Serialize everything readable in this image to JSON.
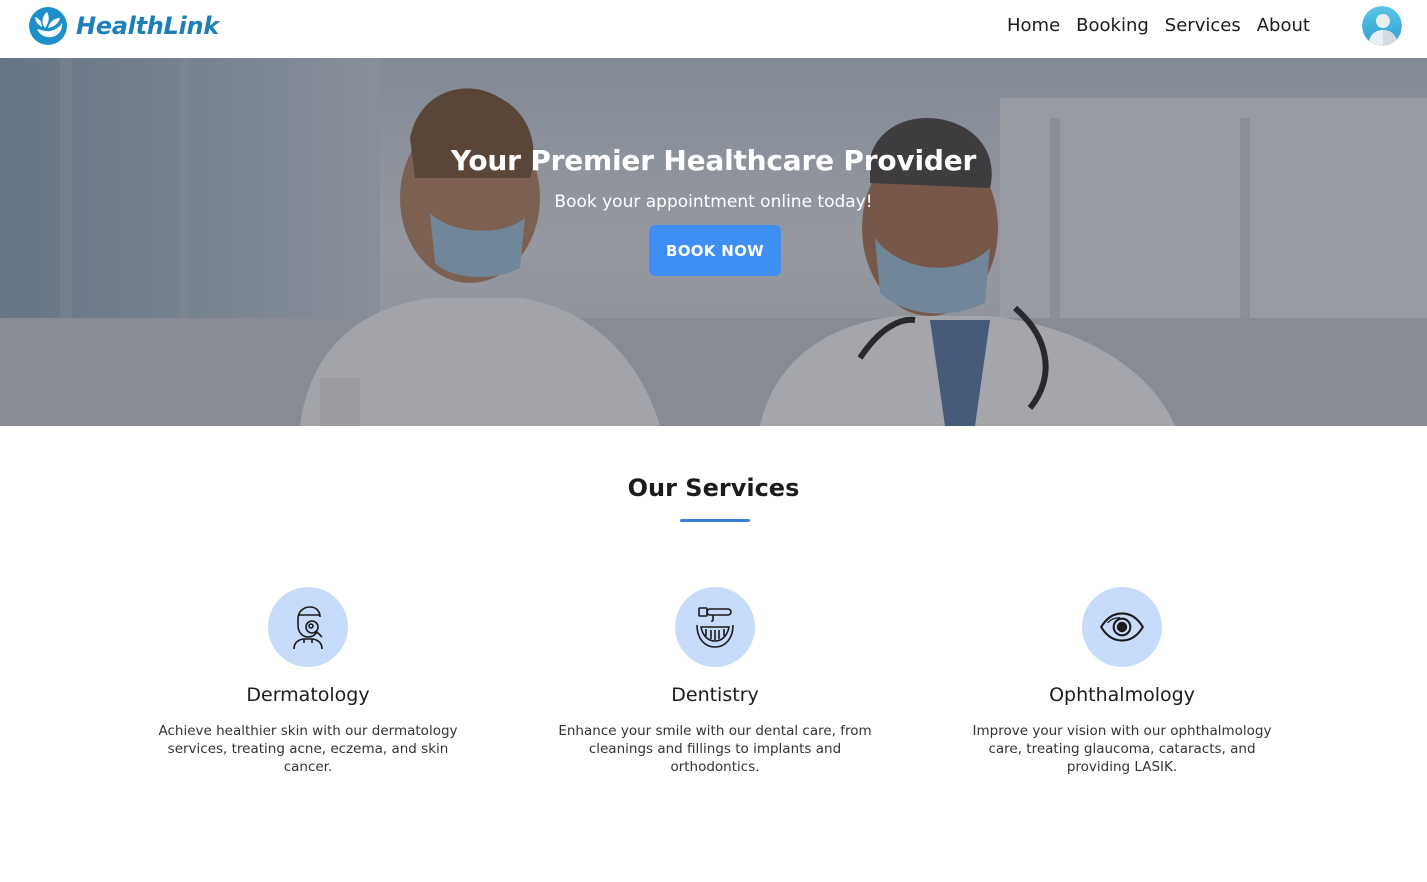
{
  "brand": {
    "name": "HealthLink",
    "logo_icon": "leaf-hand-icon",
    "color": "#1e7fb8"
  },
  "nav": {
    "items": [
      {
        "label": "Home"
      },
      {
        "label": "Booking"
      },
      {
        "label": "Services"
      },
      {
        "label": "About"
      }
    ],
    "avatar_icon": "user-avatar-icon"
  },
  "hero": {
    "title": "Your Premier Healthcare Provider",
    "subtitle": "Book your appointment online today!",
    "cta_label": "BOOK NOW",
    "cta_color": "#3f8ef4"
  },
  "services": {
    "title": "Our Services",
    "accent_color": "#3a7fd5",
    "items": [
      {
        "icon": "dermatology-magnifier-icon",
        "title": "Dermatology",
        "text": "Achieve healthier skin with our dermatology services, treating acne, eczema, and skin cancer."
      },
      {
        "icon": "dental-tool-icon",
        "title": "Dentistry",
        "text": "Enhance your smile with our dental care, from cleanings and fillings to implants and orthodontics."
      },
      {
        "icon": "eye-icon",
        "title": "Ophthalmology",
        "text": "Improve your vision with our ophthalmology care, treating glaucoma, cataracts, and providing LASIK."
      }
    ]
  }
}
